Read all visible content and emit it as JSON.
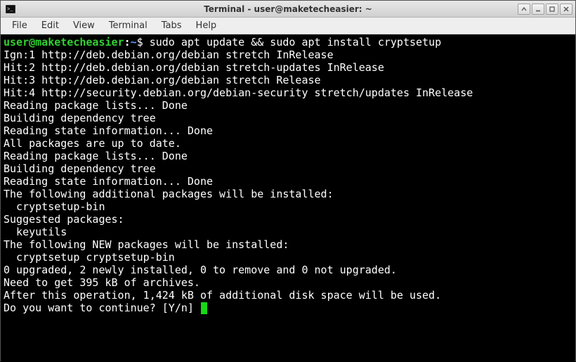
{
  "window": {
    "title": "Terminal - user@maketecheasier: ~"
  },
  "menubar": {
    "items": [
      "File",
      "Edit",
      "View",
      "Terminal",
      "Tabs",
      "Help"
    ]
  },
  "prompt": {
    "user_host": "user@maketecheasier",
    "colon": ":",
    "path": "~",
    "symbol": "$"
  },
  "command": "sudo apt update && sudo apt install cryptsetup",
  "output_lines": [
    "Ign:1 http://deb.debian.org/debian stretch InRelease",
    "Hit:2 http://deb.debian.org/debian stretch-updates InRelease",
    "Hit:3 http://deb.debian.org/debian stretch Release",
    "Hit:4 http://security.debian.org/debian-security stretch/updates InRelease",
    "Reading package lists... Done",
    "Building dependency tree",
    "Reading state information... Done",
    "All packages are up to date.",
    "Reading package lists... Done",
    "Building dependency tree",
    "Reading state information... Done",
    "The following additional packages will be installed:",
    "  cryptsetup-bin",
    "Suggested packages:",
    "  keyutils",
    "The following NEW packages will be installed:",
    "  cryptsetup cryptsetup-bin",
    "0 upgraded, 2 newly installed, 0 to remove and 0 not upgraded.",
    "Need to get 395 kB of archives.",
    "After this operation, 1,424 kB of additional disk space will be used.",
    "Do you want to continue? [Y/n] "
  ]
}
